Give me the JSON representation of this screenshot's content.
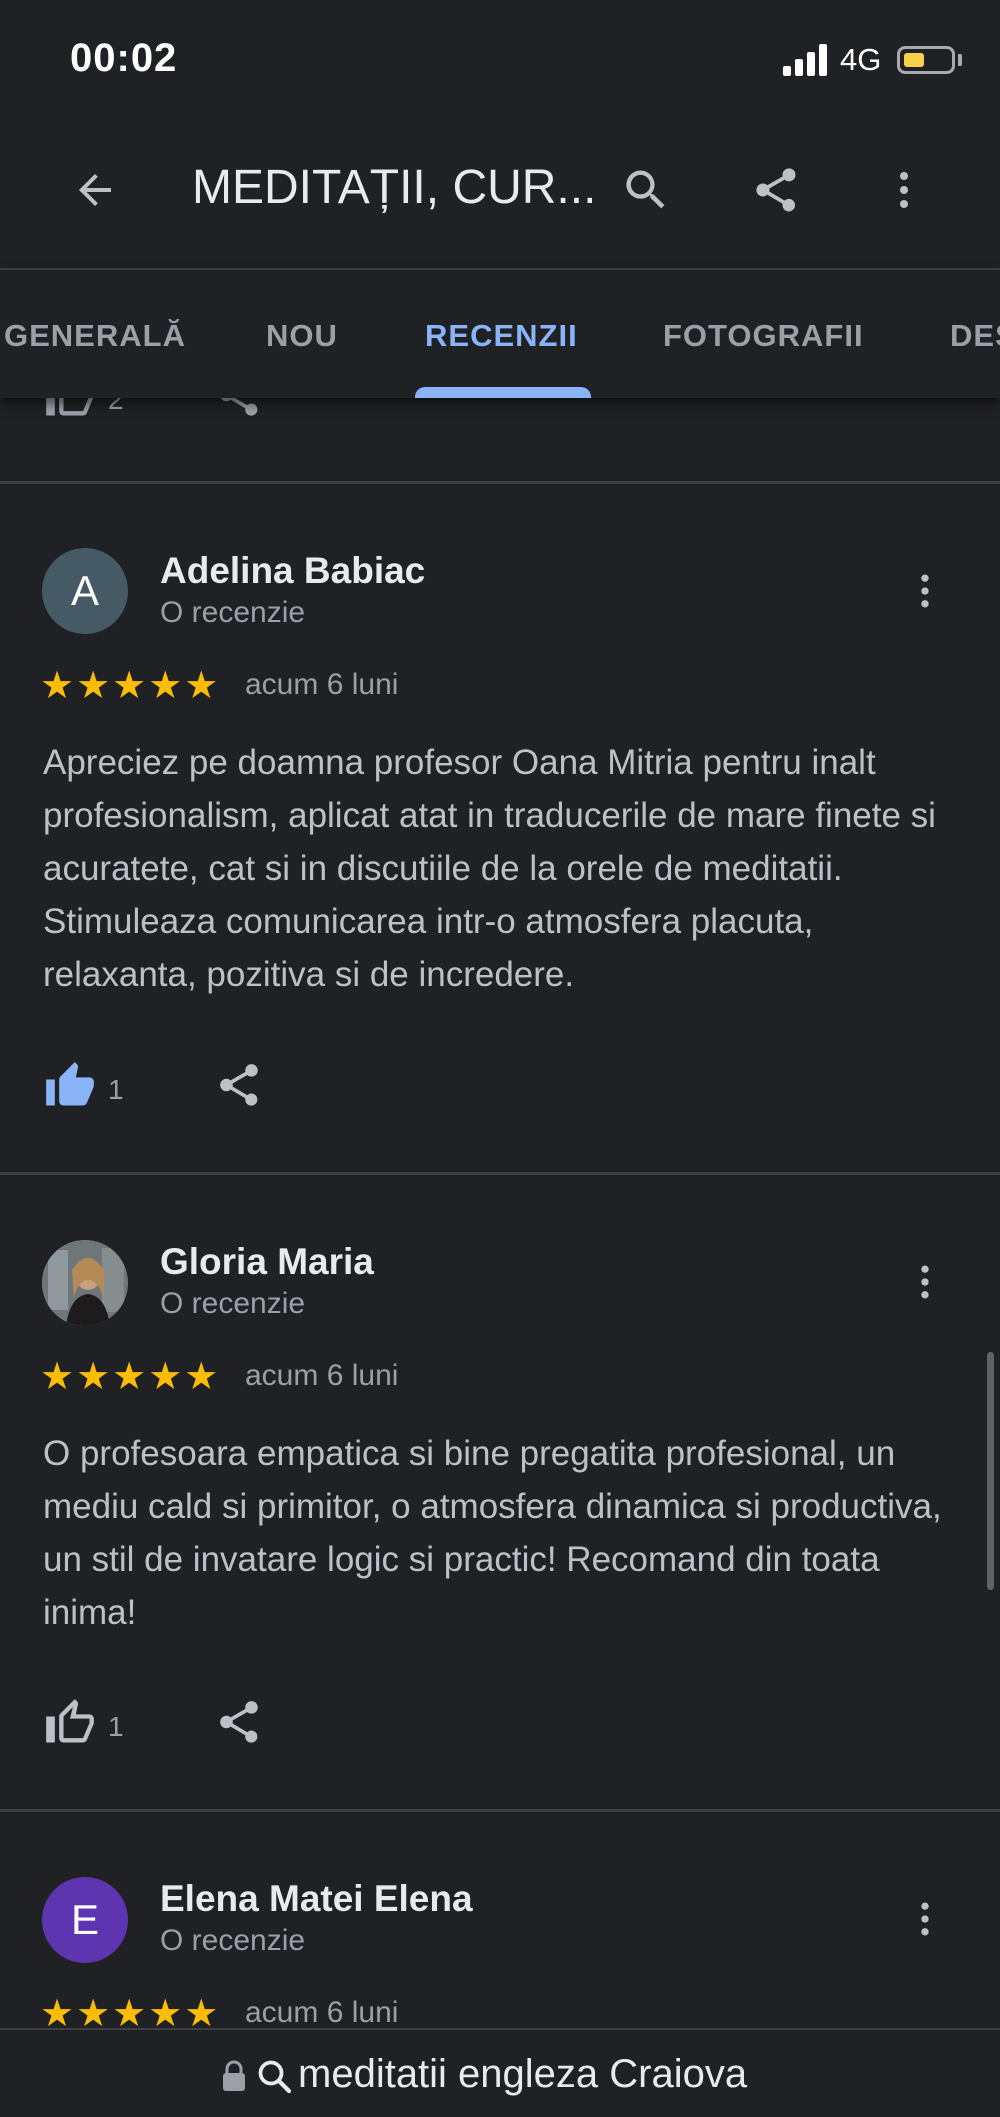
{
  "status": {
    "time": "00:02",
    "network": "4G"
  },
  "toolbar": {
    "title": "MEDITAȚII, CUR..."
  },
  "tabs": [
    {
      "label": "GENERALĂ"
    },
    {
      "label": "NOU"
    },
    {
      "label": "RECENZII"
    },
    {
      "label": "FOTOGRAFII"
    },
    {
      "label": "DES"
    }
  ],
  "prev_review": {
    "likes": "2"
  },
  "reviews": [
    {
      "initial": "A",
      "avatar_color": "#455a64",
      "name": "Adelina Babiac",
      "subtitle": "O recenzie",
      "rating": 5,
      "stars": "★★★★★",
      "date": "acum 6 luni",
      "text": "Apreciez pe doamna profesor Oana Mitria pentru inalt profesionalism, aplicat atat in traducerile de mare finete si acuratete, cat si in discutiile de la orele de meditatii. Stimuleaza comunicarea intr-o atmosfera placuta, relaxanta, pozitiva si de incredere.",
      "likes": "1",
      "liked": true
    },
    {
      "initial": "",
      "avatar_color": "#6b5a52",
      "name": "Gloria Maria",
      "subtitle": "O recenzie",
      "rating": 5,
      "stars": "★★★★★",
      "date": "acum 6 luni",
      "text": "O profesoara empatica si bine pregatita profesional, un mediu cald si primitor, o atmosfera dinamica si productiva, un stil de invatare logic si practic! Recomand din toata inima!",
      "likes": "1",
      "liked": false
    },
    {
      "initial": "E",
      "avatar_color": "#5e35b1",
      "name": "Elena Matei Elena",
      "subtitle": "O recenzie",
      "rating": 5,
      "stars": "★★★★★",
      "date": "acum 6 luni"
    }
  ],
  "url_bar": {
    "text": "meditatii engleza Craiova"
  },
  "colors": {
    "accent": "#8ab4f8",
    "star": "#fbbc04",
    "background": "#202124"
  }
}
